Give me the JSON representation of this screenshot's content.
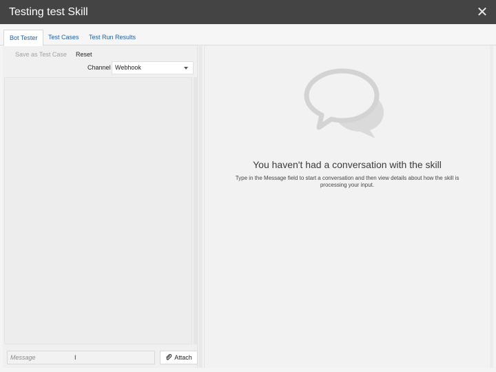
{
  "window": {
    "title": "Testing test Skill",
    "close_icon": "close-icon"
  },
  "tabs": [
    {
      "label": "Bot Tester",
      "active": true
    },
    {
      "label": "Test Cases",
      "active": false
    },
    {
      "label": "Test Run Results",
      "active": false
    }
  ],
  "tester": {
    "save_label": "Save as Test Case",
    "reset_label": "Reset",
    "channel_label": "Channel",
    "channel_value": "Webhook",
    "message_placeholder": "Message",
    "attach_label": "Attach",
    "attach_icon": "paperclip-icon"
  },
  "details": {
    "empty_icon": "chat-bubbles-icon",
    "empty_title": "You haven't had a conversation with the skill",
    "empty_description": "Type in the Message field to start a conversation and then view details about how the skill is processing your input."
  },
  "colors": {
    "titlebar_bg": "#444444",
    "tab_link": "#1b5fa8",
    "icon_gray": "#d3d3d3"
  }
}
